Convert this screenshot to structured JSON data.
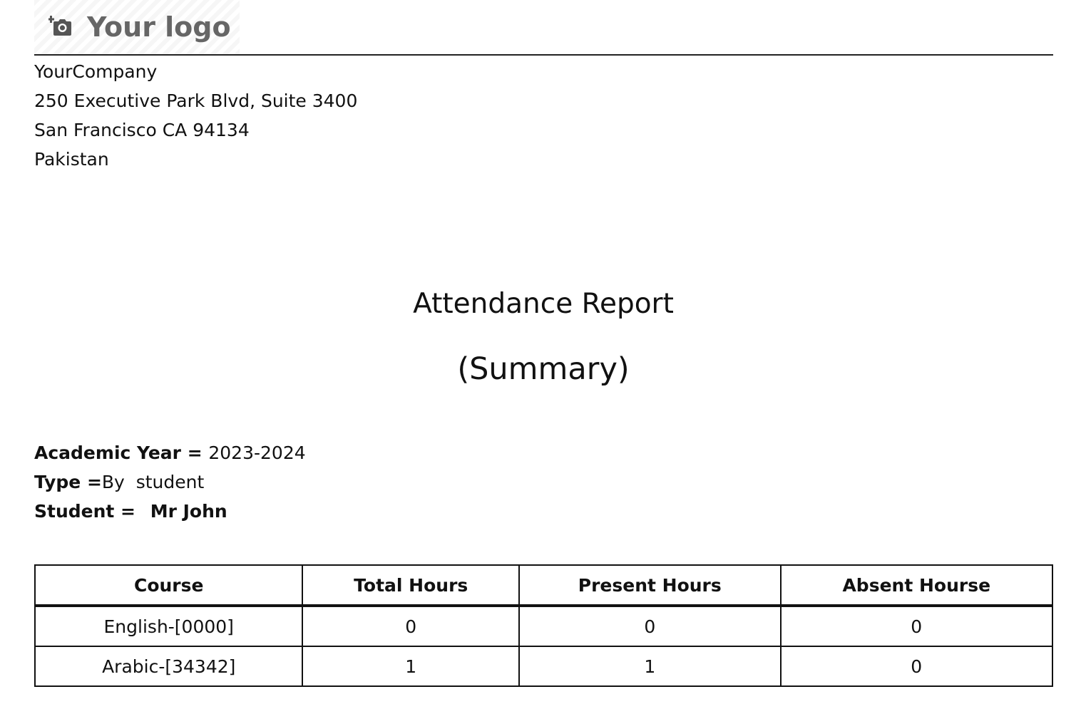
{
  "logo": {
    "icon": "camera-plus-icon",
    "text": "Your logo"
  },
  "company": {
    "name": "YourCompany",
    "address_line1": "250 Executive Park Blvd, Suite 3400",
    "address_line2": "San Francisco CA 94134",
    "country": "Pakistan"
  },
  "report": {
    "title": "Attendance Report",
    "subtitle": "(Summary)"
  },
  "filters": {
    "academic_year_label": "Academic Year = ",
    "academic_year_value": "2023-2024",
    "type_label": "Type =",
    "type_value": "By  student",
    "student_label": "Student = ",
    "student_value": "Mr John"
  },
  "table": {
    "headers": [
      "Course",
      "Total Hours",
      "Present Hours",
      "Absent Hourse"
    ],
    "rows": [
      [
        "English-[0000]",
        "0",
        "0",
        "0"
      ],
      [
        "Arabic-[34342]",
        "1",
        "1",
        "0"
      ]
    ]
  }
}
